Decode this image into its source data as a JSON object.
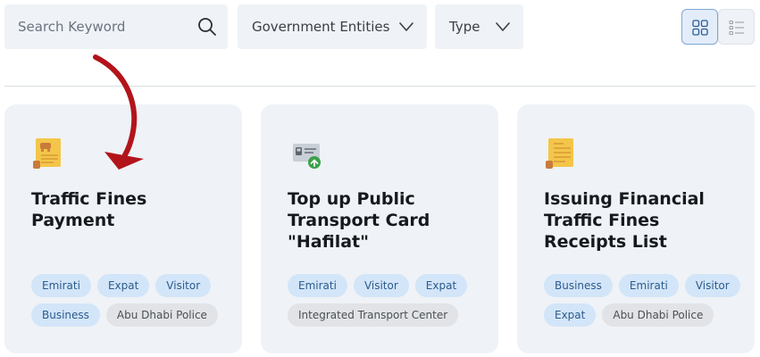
{
  "search": {
    "placeholder": "Search Keyword",
    "icon": "search-icon"
  },
  "filters": {
    "government_entities": {
      "label": "Government Entities",
      "icon": "chevron-down-icon"
    },
    "type": {
      "label": "Type",
      "icon": "chevron-down-icon"
    }
  },
  "view_toggle": {
    "grid": {
      "icon": "grid-view-icon",
      "active": true
    },
    "list": {
      "icon": "list-view-icon",
      "active": false
    }
  },
  "colors": {
    "card_bg": "#eff2f6",
    "tag_blue_bg": "#d3e5f8",
    "tag_blue_text": "#2c5b8d",
    "tag_gray_bg": "#e1e3e6",
    "accent_arrow": "#b3141b",
    "active_view_border": "#7ea6d6"
  },
  "annotation": {
    "icon": "curved-arrow-icon",
    "color": "#b3141b"
  },
  "cards": [
    {
      "icon": "traffic-fine-receipt-icon",
      "title": "Traffic Fines Payment",
      "tags": [
        {
          "label": "Emirati",
          "style": "blue"
        },
        {
          "label": "Expat",
          "style": "blue"
        },
        {
          "label": "Visitor",
          "style": "blue"
        },
        {
          "label": "Business",
          "style": "blue"
        },
        {
          "label": "Abu Dhabi Police",
          "style": "gray"
        }
      ]
    },
    {
      "icon": "transport-card-topup-icon",
      "title": "Top up Public Transport Card \"Hafilat\"",
      "tags": [
        {
          "label": "Emirati",
          "style": "blue"
        },
        {
          "label": "Visitor",
          "style": "blue"
        },
        {
          "label": "Expat",
          "style": "blue"
        },
        {
          "label": "Integrated Transport Center",
          "style": "gray"
        }
      ]
    },
    {
      "icon": "receipt-list-icon",
      "title": "Issuing Financial Traffic Fines Receipts List",
      "tags": [
        {
          "label": "Business",
          "style": "blue"
        },
        {
          "label": "Emirati",
          "style": "blue"
        },
        {
          "label": "Visitor",
          "style": "blue"
        },
        {
          "label": "Expat",
          "style": "blue"
        },
        {
          "label": "Abu Dhabi Police",
          "style": "gray"
        }
      ]
    }
  ]
}
